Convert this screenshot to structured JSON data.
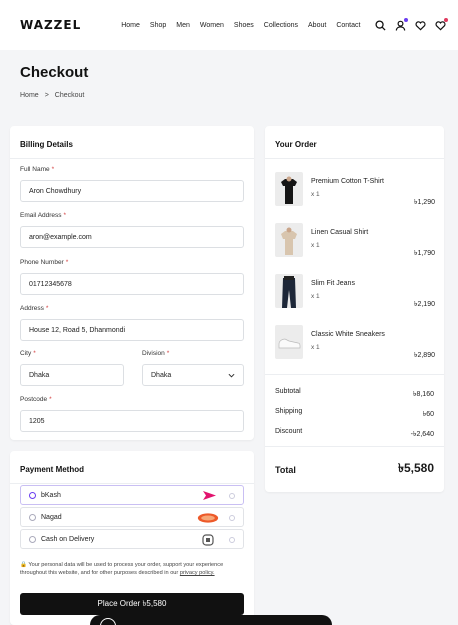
{
  "header": {
    "logo": "WAZZEL",
    "nav": [
      "Home",
      "Shop",
      "Men",
      "Women",
      "Shoes",
      "Collections",
      "About",
      "Contact"
    ],
    "icons": [
      "search-icon",
      "user-icon",
      "heart-icon",
      "wishlist-heart-icon"
    ],
    "accent": "#6a3df0"
  },
  "page": {
    "title": "Checkout",
    "breadcrumb": [
      "Home",
      ">",
      "Checkout"
    ]
  },
  "billing": {
    "title": "Billing Details",
    "required_mark": "*",
    "full_name": {
      "label": "Full Name",
      "value": "Aron Chowdhury"
    },
    "email": {
      "label": "Email Address",
      "value": "aron@example.com"
    },
    "phone": {
      "label": "Phone Number",
      "value": "01712345678"
    },
    "address": {
      "label": "Address",
      "value": "House 12, Road 5, Dhanmondi"
    },
    "city": {
      "label": "City",
      "value": "Dhaka"
    },
    "division": {
      "label": "Division",
      "value": "Dhaka"
    },
    "postcode": {
      "label": "Postcode",
      "value": "1205"
    }
  },
  "order": {
    "title": "Your Order",
    "items": [
      {
        "name": "Premium Cotton T-Shirt",
        "qty": "x 1",
        "price": "৳1,290"
      },
      {
        "name": "Linen Casual Shirt",
        "qty": "x 1",
        "price": "৳1,790"
      },
      {
        "name": "Slim Fit Jeans",
        "qty": "x 1",
        "price": "৳2,190"
      },
      {
        "name": "Classic White Sneakers",
        "qty": "x 1",
        "price": "৳2,890"
      }
    ],
    "subtotal_label": "Subtotal",
    "subtotal": "৳8,160",
    "shipping_label": "Shipping",
    "shipping": "৳60",
    "discount_label": "Discount",
    "discount": "-৳2,640",
    "total_label": "Total",
    "total": "৳5,580"
  },
  "payment": {
    "title": "Payment Method",
    "options": [
      {
        "label": "bKash",
        "selected": true
      },
      {
        "label": "Nagad",
        "selected": false
      },
      {
        "label": "Cash on Delivery",
        "selected": false
      }
    ],
    "privacy": "Your personal data will be used to process your order, support your experience throughout this website, and for other purposes described in our",
    "privacy_link": "privacy policy.",
    "place_order": "Place Order ৳5,580"
  }
}
